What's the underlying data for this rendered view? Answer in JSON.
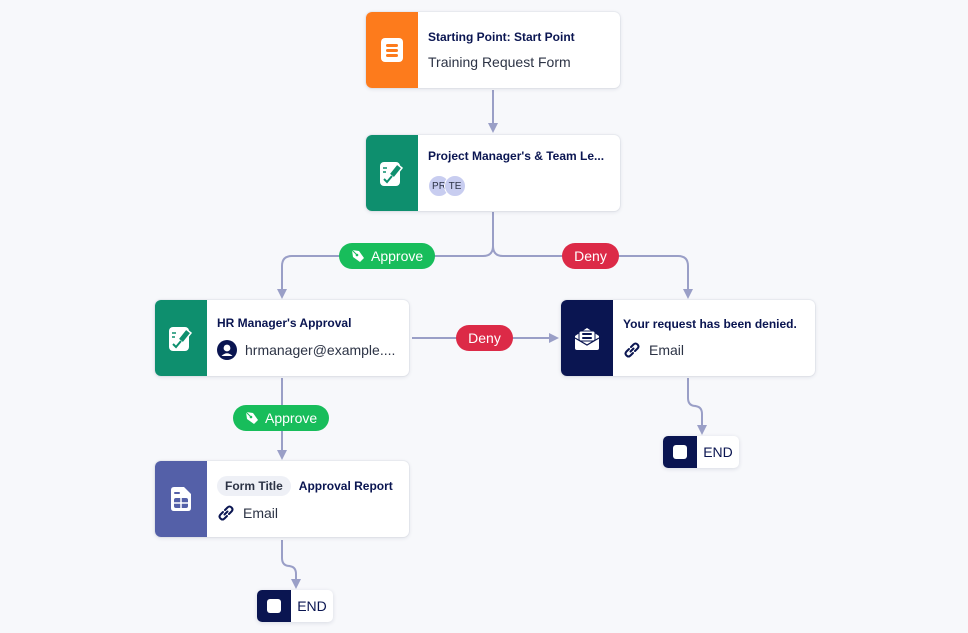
{
  "colors": {
    "start": "#fd7b1c",
    "approval": "#0e8f6e",
    "email": "#0a1551",
    "report": "#5460a8",
    "approve_pill": "#18bd5b",
    "deny_pill": "#dc2a47",
    "connector": "#9a9fc7",
    "title_text": "#0a1551"
  },
  "nodes": {
    "start": {
      "title": "Starting Point: Start Point",
      "subtitle": "Training Request Form",
      "icon": "form-icon"
    },
    "pm_approval": {
      "title": "Project Manager's & Team Le...",
      "assignees": [
        "PR",
        "TE"
      ],
      "icon": "approval-pen-icon"
    },
    "hr_approval": {
      "title": "HR Manager's Approval",
      "assignee": "hrmanager@example....",
      "icon": "approval-pen-icon"
    },
    "denied_email": {
      "title": "Your request has been denied.",
      "subtitle": "Email",
      "icon": "envelope-icon"
    },
    "report": {
      "chip": "Form Title",
      "title": "Approval Report",
      "subtitle": "Email",
      "icon": "report-sheet-icon"
    },
    "end_left": {
      "label": "END"
    },
    "end_right": {
      "label": "END"
    }
  },
  "edges": {
    "pm_approve": "Approve",
    "pm_deny": "Deny",
    "hr_deny": "Deny",
    "hr_approve": "Approve"
  }
}
